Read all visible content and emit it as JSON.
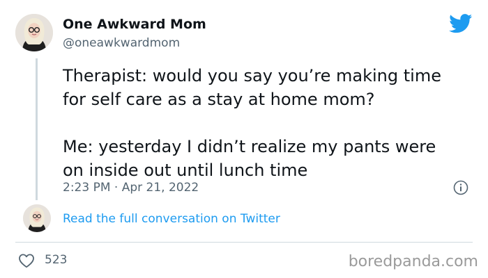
{
  "tweet": {
    "author_name": "One Awkward Mom",
    "handle": "@oneawkwardmom",
    "text_line1": "Therapist: would you say you’re making time",
    "text_line2": "for self care as a stay at home mom?",
    "text_line3": "Me: yesterday I didn’t realize my pants were",
    "text_line4": "on inside out until lunch time",
    "timestamp": "2:23 PM · Apr 21, 2022",
    "read_full_conversation": "Read the full conversation on Twitter",
    "like_count": "523"
  },
  "icons": {
    "brand": "twitter-bird-icon",
    "info": "info-icon",
    "like": "heart-icon"
  },
  "colors": {
    "link": "#1d9bf0",
    "muted": "#536471",
    "text": "#0f1419"
  },
  "watermark": "boredpanda.com"
}
